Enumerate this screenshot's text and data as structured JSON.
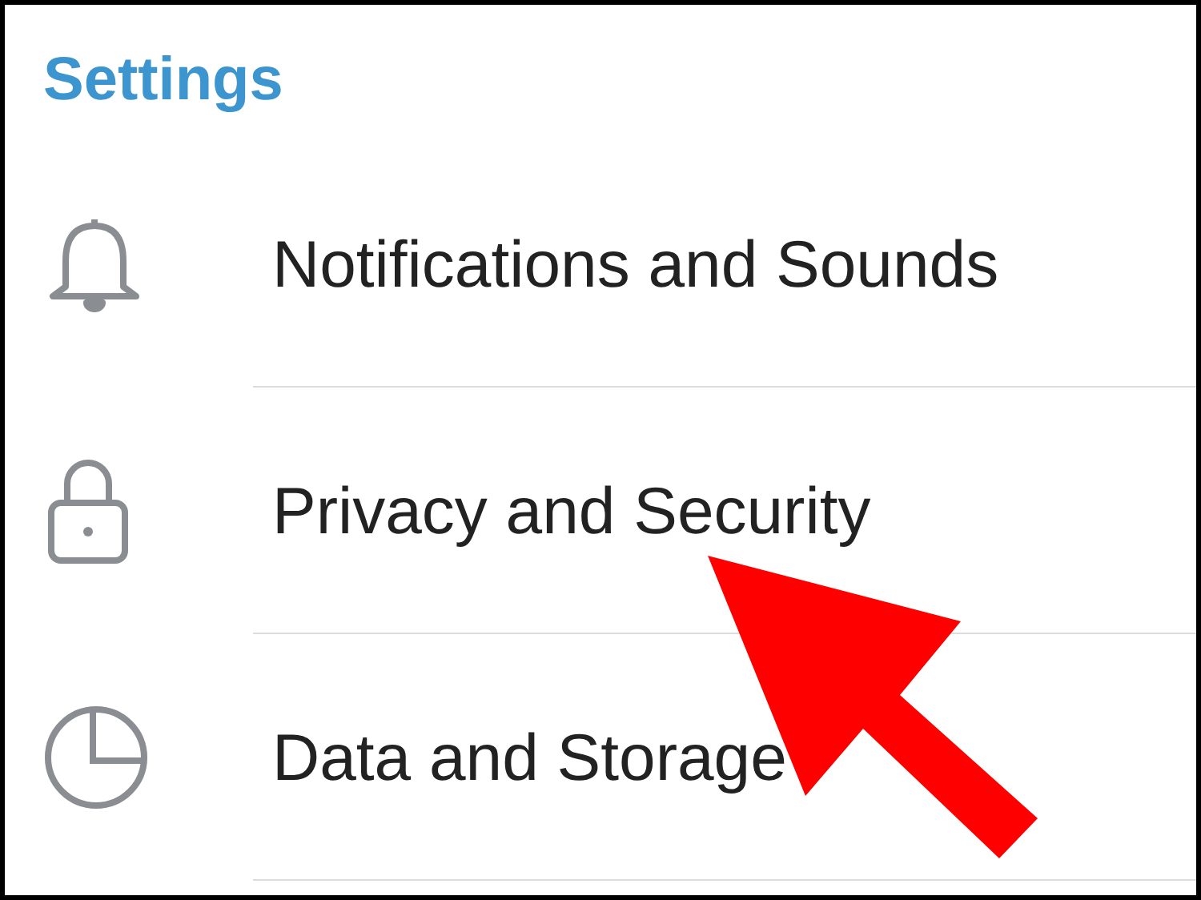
{
  "header": {
    "title": "Settings"
  },
  "items": [
    {
      "label": "Notifications and Sounds",
      "kind": "bell"
    },
    {
      "label": "Privacy and Security",
      "kind": "lock"
    },
    {
      "label": "Data and Storage",
      "kind": "pie"
    }
  ]
}
